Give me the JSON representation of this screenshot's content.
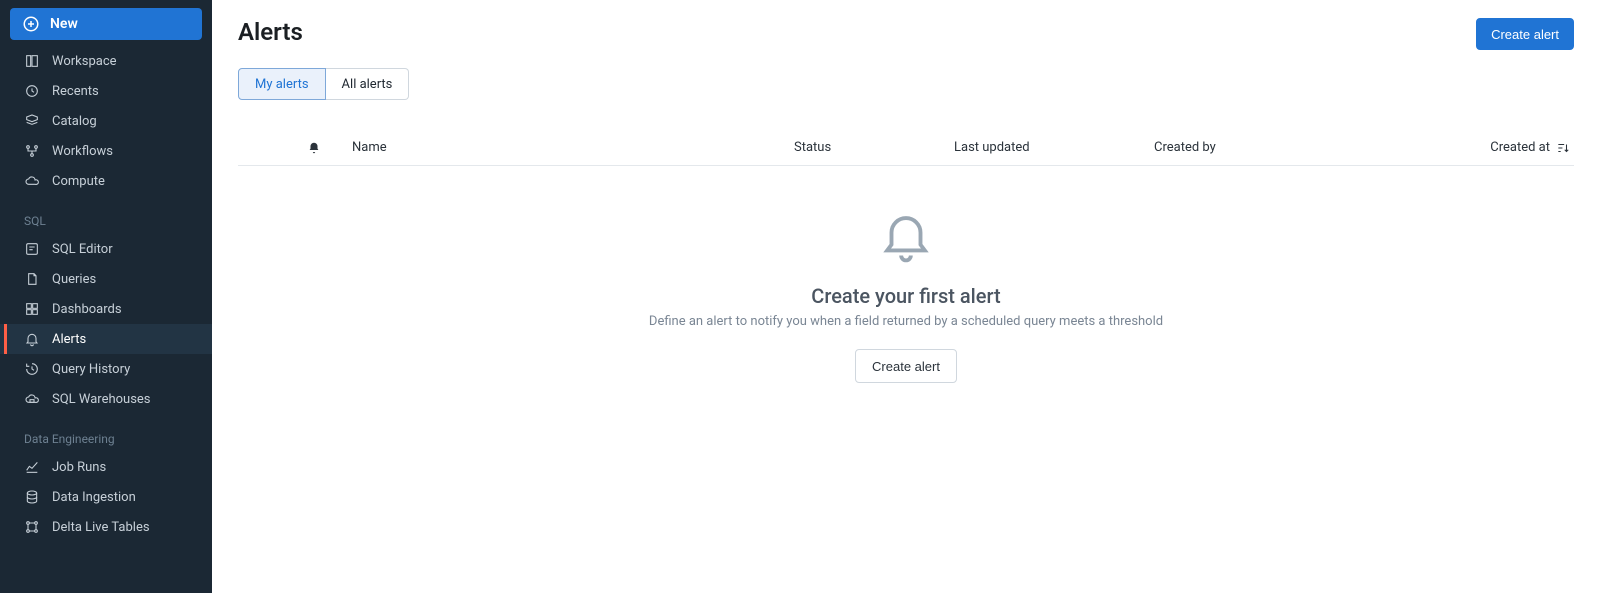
{
  "sidebar": {
    "new_label": "New",
    "items_main": [
      {
        "label": "Workspace"
      },
      {
        "label": "Recents"
      },
      {
        "label": "Catalog"
      },
      {
        "label": "Workflows"
      },
      {
        "label": "Compute"
      }
    ],
    "section_sql": "SQL",
    "items_sql": [
      {
        "label": "SQL Editor"
      },
      {
        "label": "Queries"
      },
      {
        "label": "Dashboards"
      },
      {
        "label": "Alerts"
      },
      {
        "label": "Query History"
      },
      {
        "label": "SQL Warehouses"
      }
    ],
    "section_de": "Data Engineering",
    "items_de": [
      {
        "label": "Job Runs"
      },
      {
        "label": "Data Ingestion"
      },
      {
        "label": "Delta Live Tables"
      }
    ]
  },
  "header": {
    "title": "Alerts",
    "create_btn": "Create alert"
  },
  "tabs": [
    {
      "label": "My alerts",
      "active": true
    },
    {
      "label": "All alerts",
      "active": false
    }
  ],
  "columns": {
    "name": "Name",
    "status": "Status",
    "last_updated": "Last updated",
    "created_by": "Created by",
    "created_at": "Created at"
  },
  "empty": {
    "title": "Create your first alert",
    "subtitle": "Define an alert to notify you when a field returned by a scheduled query meets a threshold",
    "button": "Create alert"
  }
}
